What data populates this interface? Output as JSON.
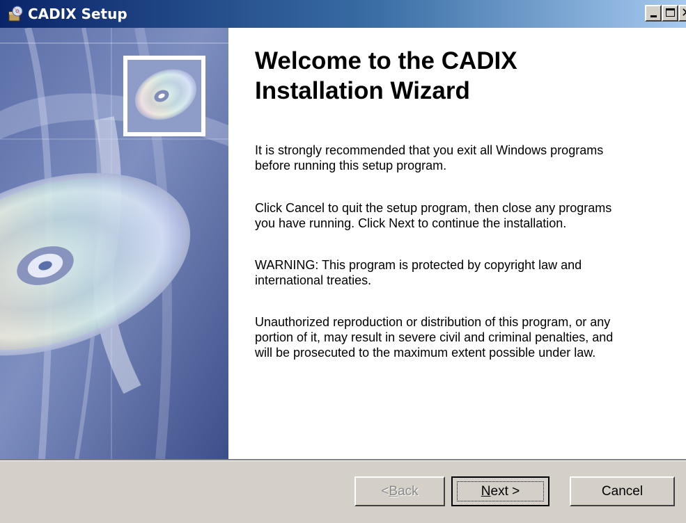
{
  "window": {
    "title": "CADIX Setup",
    "controls": [
      "minimize",
      "maximize",
      "close"
    ]
  },
  "banner": {
    "image": "cd-disc-artwork",
    "thumbnail_icon": "cd-disc-icon"
  },
  "welcome": {
    "title": "Welcome to the CADIX\nInstallation Wizard",
    "paragraphs": [
      "It is strongly recommended that you exit all Windows programs\nbefore running this setup program.",
      "Click Cancel to quit the setup program, then close any programs\nyou have running.  Click Next to continue the installation.",
      "WARNING: This program is protected by copyright law and\ninternational treaties.",
      "Unauthorized reproduction or distribution of this program, or any\nportion of it, may result in severe civil and criminal penalties, and\nwill be prosecuted to the maximum extent possible under law."
    ]
  },
  "buttons": {
    "back_prefix": "< ",
    "back_mnemonic": "B",
    "back_rest": "ack",
    "back_enabled": false,
    "next_mnemonic": "N",
    "next_rest": "ext >",
    "next_default": true,
    "cancel": "Cancel"
  },
  "colors": {
    "titlebar_start": "#0a246a",
    "titlebar_end": "#a6caf0",
    "dialog_face": "#d4d0c8",
    "banner_blue": "#4a5e99"
  }
}
